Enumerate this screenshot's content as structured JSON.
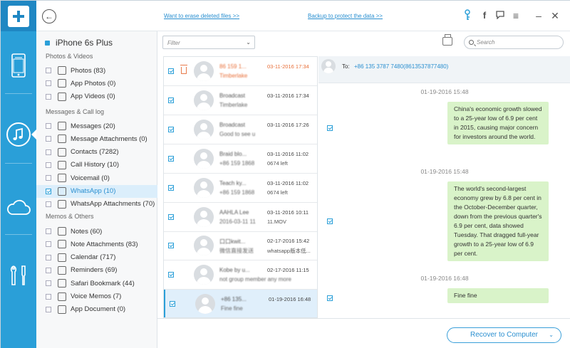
{
  "app": {
    "links": {
      "erase": "Want to erase deleted files >>",
      "backup": "Backup to protect the data >>"
    },
    "accent": "#2a9fd8"
  },
  "rail": {
    "items": [
      "device-icon",
      "music-icon",
      "cloud-icon",
      "tools-icon"
    ]
  },
  "sidebar": {
    "device": "iPhone 6s Plus",
    "sections": [
      {
        "title": "Photos & Videos",
        "items": [
          {
            "label": "Photos (83)",
            "icon": "photo-icon"
          },
          {
            "label": "App Photos (0)",
            "icon": "app-photos-icon"
          },
          {
            "label": "App Videos (0)",
            "icon": "app-videos-icon"
          }
        ]
      },
      {
        "title": "Messages & Call log",
        "items": [
          {
            "label": "Messages (20)",
            "icon": "message-icon"
          },
          {
            "label": "Message Attachments (0)",
            "icon": "attachment-icon"
          },
          {
            "label": "Contacts (7282)",
            "icon": "contacts-icon"
          },
          {
            "label": "Call History (10)",
            "icon": "phone-icon"
          },
          {
            "label": "Voicemail (0)",
            "icon": "voicemail-icon"
          },
          {
            "label": "WhatsApp (10)",
            "icon": "whatsapp-icon"
          },
          {
            "label": "WhatsApp Attachments (70)",
            "icon": "attachment-icon"
          }
        ]
      },
      {
        "title": "Memos & Others",
        "items": [
          {
            "label": "Notes (60)",
            "icon": "notes-icon"
          },
          {
            "label": "Note Attachments (83)",
            "icon": "attachment-icon"
          },
          {
            "label": "Calendar (717)",
            "icon": "calendar-icon"
          },
          {
            "label": "Reminders (69)",
            "icon": "reminders-icon"
          },
          {
            "label": "Safari Bookmark (44)",
            "icon": "bookmark-icon"
          },
          {
            "label": "Voice Memos (7)",
            "icon": "microphone-icon"
          },
          {
            "label": "App Document (0)",
            "icon": "document-icon"
          }
        ]
      }
    ]
  },
  "toolbar": {
    "filter_placeholder": "Filter",
    "search_placeholder": "Search"
  },
  "conversations": [
    {
      "name": "86 159 1...",
      "preview": "Timberlake",
      "date": "03-11-2016 17:34",
      "extra": "",
      "deleted": true
    },
    {
      "name": "Broadcast",
      "preview": "Timberlake",
      "date": "03-11-2016 17:34",
      "extra": "",
      "deleted": false
    },
    {
      "name": "Broadcast",
      "preview": "Good to see u",
      "date": "03-11-2016 17:26",
      "extra": "",
      "deleted": false
    },
    {
      "name": "Braid blo...",
      "preview": "+86 159 1868",
      "date": "03-11-2016 11:02",
      "extra": "0674 left",
      "deleted": false
    },
    {
      "name": "Teach ky...",
      "preview": "+86 159 1868",
      "date": "03-11-2016 11:02",
      "extra": "0674 left",
      "deleted": false
    },
    {
      "name": "AAHLA Lee",
      "preview": "2016-03-11 11",
      "date": "03-11-2016 10:11",
      "extra": "11.MOV",
      "deleted": false
    },
    {
      "name": "口口kwit...",
      "preview": "微信直接发送",
      "date": "02-17-2016 15:42",
      "extra": "whatsapp版本低...",
      "deleted": false
    },
    {
      "name": "Kobe by u...",
      "preview": "not group member any more",
      "date": "02-17-2016 11:15",
      "extra": "",
      "deleted": false
    },
    {
      "name": "+86 135...",
      "preview": "Fine fine",
      "date": "01-19-2016 16:48",
      "extra": "",
      "deleted": false
    }
  ],
  "chat": {
    "to_label": "To:",
    "to_value": "+86 135 3787 7480(8613537877480)",
    "messages": [
      {
        "time": "01-19-2016 15:48",
        "text": "China's economic growth slowed to a 25-year low of 6.9 per cent in 2015, causing major concern for investors around the world."
      },
      {
        "time": "01-19-2016 15:48",
        "text": "The world's second-largest economy grew by 6.8 per cent in the October-December quarter, down from the previous quarter's 6.9 per cent, data showed Tuesday. That dragged full-year growth to a 25-year low of 6.9 per cent."
      },
      {
        "time": "01-19-2016 16:48",
        "text": "Fine fine"
      }
    ]
  },
  "footer": {
    "recover": "Recover to Computer"
  }
}
